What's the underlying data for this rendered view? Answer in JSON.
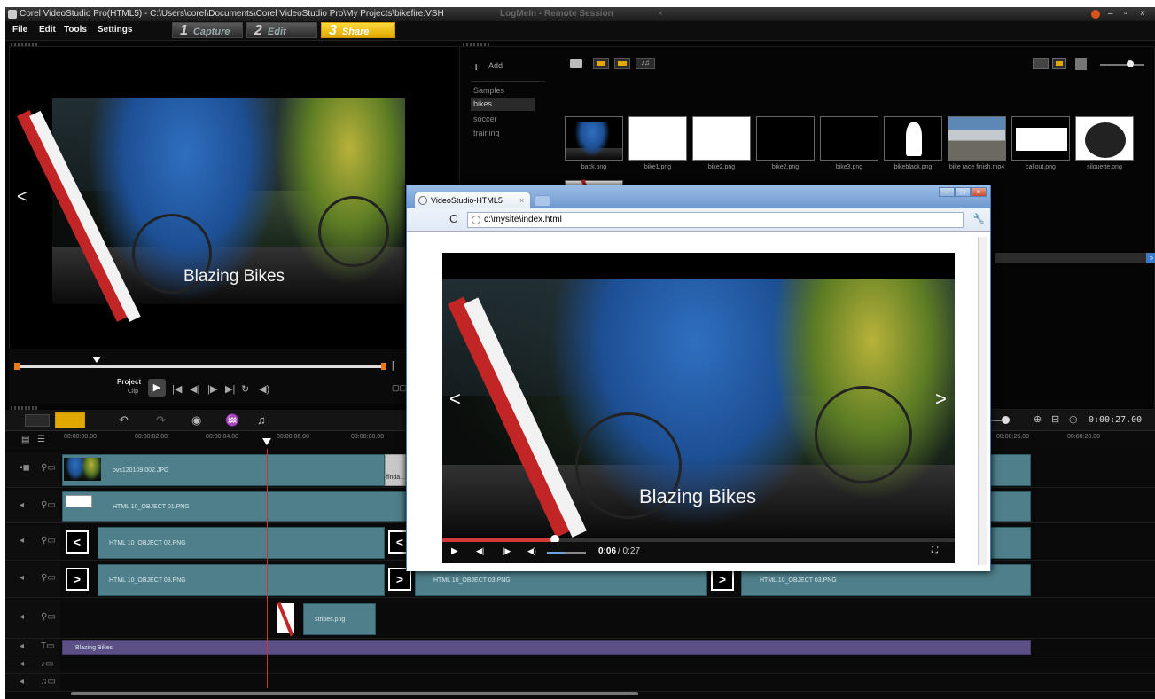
{
  "app": {
    "title": "Corel VideoStudio Pro(HTML5) - C:\\Users\\corel\\Documents\\Corel VideoStudio Pro\\My Projects\\bikefire.VSH",
    "remote_session": "LogMeIn - Remote Session",
    "menus": [
      "File",
      "Edit",
      "Tools",
      "Settings"
    ],
    "steps": [
      {
        "num": "1",
        "label": "Capture"
      },
      {
        "num": "2",
        "label": "Edit"
      },
      {
        "num": "3",
        "label": "Share"
      }
    ]
  },
  "preview": {
    "caption": "Blazing Bikes",
    "prev_glyph": "<",
    "project_label": "Project",
    "clip_label": "Clip"
  },
  "library": {
    "add_label": "Add",
    "folders": [
      "Samples",
      "bikes",
      "soccer",
      "training"
    ],
    "selected_folder": "bikes",
    "thumbnails": [
      "back.png",
      "bike1.png",
      "bike2.png",
      "bike2.png",
      "bike3.png",
      "bikeblack.png",
      "bike race finish.mp4",
      "callout.png",
      "silouette.png"
    ]
  },
  "timeline": {
    "timecode": "0:00:27.00",
    "ruler": [
      "00:00:00.00",
      "00:00:02.00",
      "00:00:04.00",
      "00:00:06.00",
      "00:00:08.00",
      "00:00:26.00",
      "00:00:28.00"
    ],
    "tracks": {
      "video_clip": "ovs120109 002.JPG",
      "next_clip_label": "finda...",
      "overlay1": "HTML 10_OBJECT 01.PNG",
      "overlay2": "HTML 10_OBJECT 02.PNG",
      "overlay3": "HTML 10_OBJECT 03.PNG",
      "overlay3b": "HTML 10_OBJECT 03.PNG",
      "overlay3c": "HTML 10_OBJECT 03.PNG",
      "stripes": "stripes.png",
      "title": "Blazing Bikes"
    }
  },
  "browser": {
    "tab_title": "VideoStudio-HTML5",
    "url": "c:\\mysite\\index.html",
    "caption": "Blazing Bikes",
    "prev_glyph": "<",
    "next_glyph": ">",
    "time_current": "0:06",
    "time_total": " / 0:27",
    "progress": 0.22
  },
  "colors": {
    "clip_teal": "#4e7f8a",
    "title_track_purple": "#5b4f86",
    "stripe_red": "#c22525",
    "step_active": "#f2c200"
  }
}
